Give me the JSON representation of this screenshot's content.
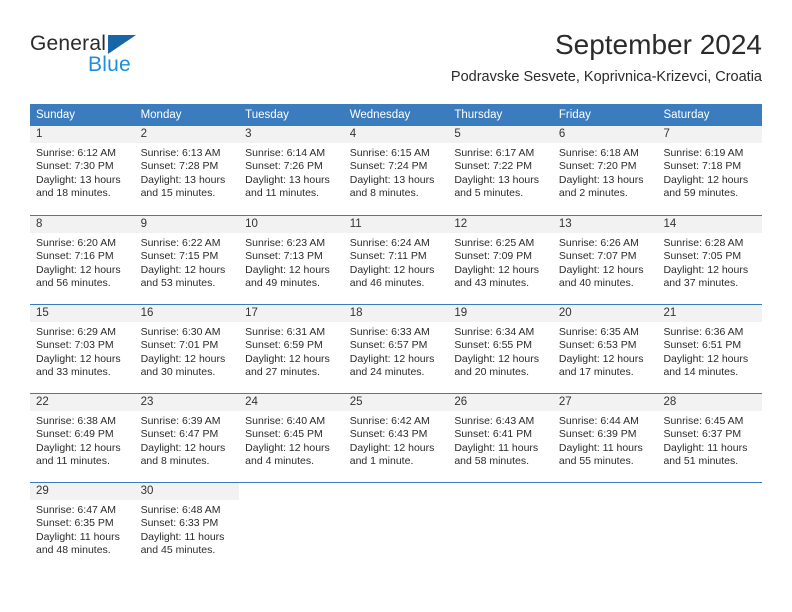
{
  "brand": {
    "name_part1": "General",
    "name_part2": "Blue",
    "triangle_color": "#1767a8",
    "blue_color": "#1f8fdd"
  },
  "header": {
    "month_title": "September 2024",
    "location": "Podravske Sesvete, Koprivnica-Krizevci, Croatia"
  },
  "theme": {
    "header_blue": "#3a7cbd",
    "day_band_gray": "#f2f2f2",
    "text_color": "#2b2b2b"
  },
  "weekdays": [
    "Sunday",
    "Monday",
    "Tuesday",
    "Wednesday",
    "Thursday",
    "Friday",
    "Saturday"
  ],
  "weeks": [
    [
      {
        "day": "1",
        "sunrise": "Sunrise: 6:12 AM",
        "sunset": "Sunset: 7:30 PM",
        "daylight_line1": "Daylight: 13 hours",
        "daylight_line2": "and 18 minutes."
      },
      {
        "day": "2",
        "sunrise": "Sunrise: 6:13 AM",
        "sunset": "Sunset: 7:28 PM",
        "daylight_line1": "Daylight: 13 hours",
        "daylight_line2": "and 15 minutes."
      },
      {
        "day": "3",
        "sunrise": "Sunrise: 6:14 AM",
        "sunset": "Sunset: 7:26 PM",
        "daylight_line1": "Daylight: 13 hours",
        "daylight_line2": "and 11 minutes."
      },
      {
        "day": "4",
        "sunrise": "Sunrise: 6:15 AM",
        "sunset": "Sunset: 7:24 PM",
        "daylight_line1": "Daylight: 13 hours",
        "daylight_line2": "and 8 minutes."
      },
      {
        "day": "5",
        "sunrise": "Sunrise: 6:17 AM",
        "sunset": "Sunset: 7:22 PM",
        "daylight_line1": "Daylight: 13 hours",
        "daylight_line2": "and 5 minutes."
      },
      {
        "day": "6",
        "sunrise": "Sunrise: 6:18 AM",
        "sunset": "Sunset: 7:20 PM",
        "daylight_line1": "Daylight: 13 hours",
        "daylight_line2": "and 2 minutes."
      },
      {
        "day": "7",
        "sunrise": "Sunrise: 6:19 AM",
        "sunset": "Sunset: 7:18 PM",
        "daylight_line1": "Daylight: 12 hours",
        "daylight_line2": "and 59 minutes."
      }
    ],
    [
      {
        "day": "8",
        "sunrise": "Sunrise: 6:20 AM",
        "sunset": "Sunset: 7:16 PM",
        "daylight_line1": "Daylight: 12 hours",
        "daylight_line2": "and 56 minutes."
      },
      {
        "day": "9",
        "sunrise": "Sunrise: 6:22 AM",
        "sunset": "Sunset: 7:15 PM",
        "daylight_line1": "Daylight: 12 hours",
        "daylight_line2": "and 53 minutes."
      },
      {
        "day": "10",
        "sunrise": "Sunrise: 6:23 AM",
        "sunset": "Sunset: 7:13 PM",
        "daylight_line1": "Daylight: 12 hours",
        "daylight_line2": "and 49 minutes."
      },
      {
        "day": "11",
        "sunrise": "Sunrise: 6:24 AM",
        "sunset": "Sunset: 7:11 PM",
        "daylight_line1": "Daylight: 12 hours",
        "daylight_line2": "and 46 minutes."
      },
      {
        "day": "12",
        "sunrise": "Sunrise: 6:25 AM",
        "sunset": "Sunset: 7:09 PM",
        "daylight_line1": "Daylight: 12 hours",
        "daylight_line2": "and 43 minutes."
      },
      {
        "day": "13",
        "sunrise": "Sunrise: 6:26 AM",
        "sunset": "Sunset: 7:07 PM",
        "daylight_line1": "Daylight: 12 hours",
        "daylight_line2": "and 40 minutes."
      },
      {
        "day": "14",
        "sunrise": "Sunrise: 6:28 AM",
        "sunset": "Sunset: 7:05 PM",
        "daylight_line1": "Daylight: 12 hours",
        "daylight_line2": "and 37 minutes."
      }
    ],
    [
      {
        "day": "15",
        "sunrise": "Sunrise: 6:29 AM",
        "sunset": "Sunset: 7:03 PM",
        "daylight_line1": "Daylight: 12 hours",
        "daylight_line2": "and 33 minutes."
      },
      {
        "day": "16",
        "sunrise": "Sunrise: 6:30 AM",
        "sunset": "Sunset: 7:01 PM",
        "daylight_line1": "Daylight: 12 hours",
        "daylight_line2": "and 30 minutes."
      },
      {
        "day": "17",
        "sunrise": "Sunrise: 6:31 AM",
        "sunset": "Sunset: 6:59 PM",
        "daylight_line1": "Daylight: 12 hours",
        "daylight_line2": "and 27 minutes."
      },
      {
        "day": "18",
        "sunrise": "Sunrise: 6:33 AM",
        "sunset": "Sunset: 6:57 PM",
        "daylight_line1": "Daylight: 12 hours",
        "daylight_line2": "and 24 minutes."
      },
      {
        "day": "19",
        "sunrise": "Sunrise: 6:34 AM",
        "sunset": "Sunset: 6:55 PM",
        "daylight_line1": "Daylight: 12 hours",
        "daylight_line2": "and 20 minutes."
      },
      {
        "day": "20",
        "sunrise": "Sunrise: 6:35 AM",
        "sunset": "Sunset: 6:53 PM",
        "daylight_line1": "Daylight: 12 hours",
        "daylight_line2": "and 17 minutes."
      },
      {
        "day": "21",
        "sunrise": "Sunrise: 6:36 AM",
        "sunset": "Sunset: 6:51 PM",
        "daylight_line1": "Daylight: 12 hours",
        "daylight_line2": "and 14 minutes."
      }
    ],
    [
      {
        "day": "22",
        "sunrise": "Sunrise: 6:38 AM",
        "sunset": "Sunset: 6:49 PM",
        "daylight_line1": "Daylight: 12 hours",
        "daylight_line2": "and 11 minutes."
      },
      {
        "day": "23",
        "sunrise": "Sunrise: 6:39 AM",
        "sunset": "Sunset: 6:47 PM",
        "daylight_line1": "Daylight: 12 hours",
        "daylight_line2": "and 8 minutes."
      },
      {
        "day": "24",
        "sunrise": "Sunrise: 6:40 AM",
        "sunset": "Sunset: 6:45 PM",
        "daylight_line1": "Daylight: 12 hours",
        "daylight_line2": "and 4 minutes."
      },
      {
        "day": "25",
        "sunrise": "Sunrise: 6:42 AM",
        "sunset": "Sunset: 6:43 PM",
        "daylight_line1": "Daylight: 12 hours",
        "daylight_line2": "and 1 minute."
      },
      {
        "day": "26",
        "sunrise": "Sunrise: 6:43 AM",
        "sunset": "Sunset: 6:41 PM",
        "daylight_line1": "Daylight: 11 hours",
        "daylight_line2": "and 58 minutes."
      },
      {
        "day": "27",
        "sunrise": "Sunrise: 6:44 AM",
        "sunset": "Sunset: 6:39 PM",
        "daylight_line1": "Daylight: 11 hours",
        "daylight_line2": "and 55 minutes."
      },
      {
        "day": "28",
        "sunrise": "Sunrise: 6:45 AM",
        "sunset": "Sunset: 6:37 PM",
        "daylight_line1": "Daylight: 11 hours",
        "daylight_line2": "and 51 minutes."
      }
    ],
    [
      {
        "day": "29",
        "sunrise": "Sunrise: 6:47 AM",
        "sunset": "Sunset: 6:35 PM",
        "daylight_line1": "Daylight: 11 hours",
        "daylight_line2": "and 48 minutes."
      },
      {
        "day": "30",
        "sunrise": "Sunrise: 6:48 AM",
        "sunset": "Sunset: 6:33 PM",
        "daylight_line1": "Daylight: 11 hours",
        "daylight_line2": "and 45 minutes."
      },
      {
        "day": "",
        "sunrise": "",
        "sunset": "",
        "daylight_line1": "",
        "daylight_line2": ""
      },
      {
        "day": "",
        "sunrise": "",
        "sunset": "",
        "daylight_line1": "",
        "daylight_line2": ""
      },
      {
        "day": "",
        "sunrise": "",
        "sunset": "",
        "daylight_line1": "",
        "daylight_line2": ""
      },
      {
        "day": "",
        "sunrise": "",
        "sunset": "",
        "daylight_line1": "",
        "daylight_line2": ""
      },
      {
        "day": "",
        "sunrise": "",
        "sunset": "",
        "daylight_line1": "",
        "daylight_line2": ""
      }
    ]
  ]
}
